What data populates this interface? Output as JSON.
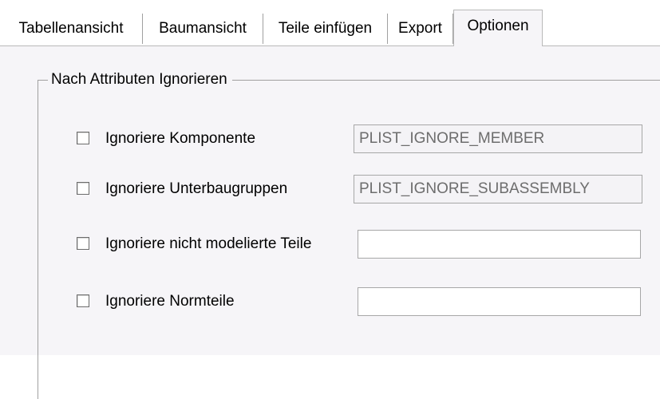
{
  "tabs": [
    {
      "label": "Tabellenansicht",
      "active": false
    },
    {
      "label": "Baumansicht",
      "active": false
    },
    {
      "label": "Teile einfügen",
      "active": false
    },
    {
      "label": "Export",
      "active": false
    },
    {
      "label": "Optionen",
      "active": true
    }
  ],
  "group": {
    "title": "Nach Attributen Ignorieren",
    "rows": [
      {
        "label": "Ignoriere Komponente",
        "checked": false,
        "value": "PLIST_IGNORE_MEMBER",
        "editable": false
      },
      {
        "label": "Ignoriere Unterbaugruppen",
        "checked": false,
        "value": "PLIST_IGNORE_SUBASSEMBLY",
        "editable": false
      },
      {
        "label": "Ignoriere nicht modelierte Teile",
        "checked": false,
        "value": "",
        "editable": true
      },
      {
        "label": "Ignoriere Normteile",
        "checked": false,
        "value": "",
        "editable": true
      }
    ]
  },
  "colors": {
    "panel_bg": "#f6f5f8",
    "tab_bg": "#ffffff",
    "border": "#a0a0a0",
    "readonly_text": "#6d6d6d"
  }
}
